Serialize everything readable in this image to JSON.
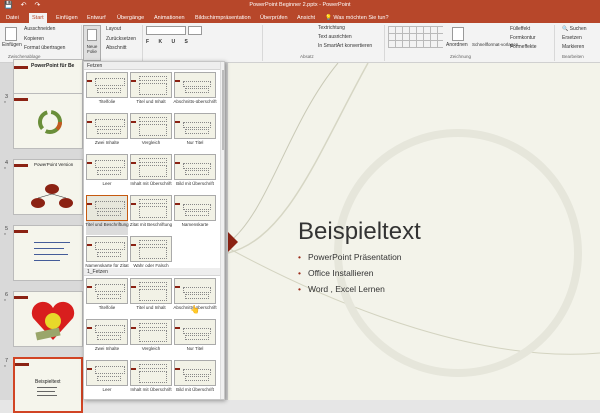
{
  "window": {
    "title": "PowerPoint Beginner 2.pptx - PowerPoint"
  },
  "tabs": [
    {
      "label": "Datei"
    },
    {
      "label": "Start"
    },
    {
      "label": "Einfügen"
    },
    {
      "label": "Entwurf"
    },
    {
      "label": "Übergänge"
    },
    {
      "label": "Animationen"
    },
    {
      "label": "Bildschirmpräsentation"
    },
    {
      "label": "Überprüfen"
    },
    {
      "label": "Ansicht"
    }
  ],
  "tell_me": "Was möchten Sie tun?",
  "ribbon": {
    "clipboard": {
      "paste": "Einfügen",
      "cut": "Ausschneiden",
      "copy": "Kopieren",
      "format_painter": "Format übertragen",
      "group": "Zwischenablage"
    },
    "slides": {
      "new_slide": "Neue Folie",
      "layout": "Layout",
      "reset": "Zurücksetzen",
      "section": "Abschnitt"
    },
    "paragraph": {
      "text_direction": "Textrichtung",
      "align_text": "Text ausrichten",
      "smartart": "In SmartArt konvertieren",
      "group": "Absatz"
    },
    "drawing": {
      "arrange": "Anordnen",
      "quick_styles": "Schnellformat-vorlagen",
      "fill": "Fülleffekt",
      "outline": "Formkontur",
      "effects": "Formeffekte",
      "group": "Zeichnung"
    },
    "editing": {
      "find": "Suchen",
      "replace": "Ersetzen",
      "select": "Markieren",
      "group": "Bearbeiten"
    }
  },
  "thumbnails": [
    {
      "num": "",
      "title": "PowerPoint für Be"
    },
    {
      "num": "3",
      "title": ""
    },
    {
      "num": "4",
      "title": "PowerPoint Version"
    },
    {
      "num": "5",
      "title": ""
    },
    {
      "num": "6",
      "title": ""
    },
    {
      "num": "7",
      "title": "Beispieltext"
    }
  ],
  "layout_gallery": {
    "sections": [
      "Fetzen",
      "1_Fetzen"
    ],
    "layouts": [
      "Titelfolie",
      "Titel und Inhalt",
      "Abschnitts-überschrift",
      "Zwei Inhalte",
      "Vergleich",
      "Nur Titel",
      "Leer",
      "Inhalt mit Überschrift",
      "Bild mit Überschrift",
      "Titel und Beschriftung",
      "Zitat mit Beschriftung",
      "Namenskarte",
      "Namenskarte für Zitat",
      "Wahr oder Falsch"
    ],
    "layouts2": [
      "Titelfolie",
      "Titel und Inhalt",
      "Abschnitts-überschrift",
      "Zwei Inhalte",
      "Vergleich",
      "Nur Titel",
      "Leer",
      "Inhalt mit Überschrift",
      "Bild mit Überschrift"
    ]
  },
  "slide": {
    "title": "Beispieltext",
    "bullets": [
      "PowerPoint Präsentation",
      "Office Installieren",
      "Word , Excel Lernen"
    ]
  },
  "colors": {
    "accent": "#b7472a",
    "dark_red": "#8b2213"
  }
}
